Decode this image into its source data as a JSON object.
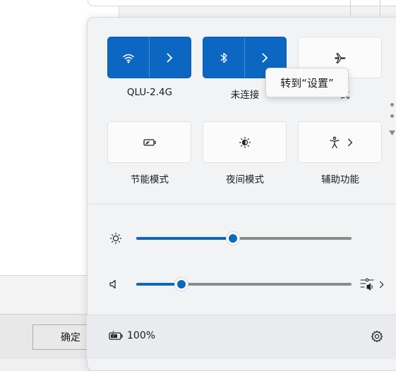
{
  "background_dialog": {
    "ok_button_label": "确定"
  },
  "tiles": [
    {
      "label": "QLU-2.4G",
      "icon": "wifi-icon",
      "state": "on"
    },
    {
      "label": "未连接",
      "icon": "bluetooth-icon",
      "state": "on"
    },
    {
      "label": "飞行模式",
      "visible_label_fragment": "式",
      "icon": "airplane-icon",
      "state": "off"
    },
    {
      "label": "节能模式",
      "icon": "battery-saver-icon",
      "state": "off"
    },
    {
      "label": "夜间模式",
      "icon": "night-light-icon",
      "state": "off"
    },
    {
      "label": "辅助功能",
      "icon": "accessibility-icon",
      "state": "off"
    }
  ],
  "tooltip": {
    "text": "转到“设置”"
  },
  "sliders": {
    "brightness": {
      "icon": "brightness-icon",
      "level_percent": 45
    },
    "volume": {
      "icon": "speaker-icon",
      "level_percent": 21,
      "right_icon": "audio-output-icon"
    }
  },
  "footer": {
    "battery_percent": "100%",
    "battery_icon": "battery-charging-icon",
    "settings_icon": "gear-icon"
  },
  "colors": {
    "accent": "#0b67c2",
    "panel_bg": "#f2f3f5"
  }
}
